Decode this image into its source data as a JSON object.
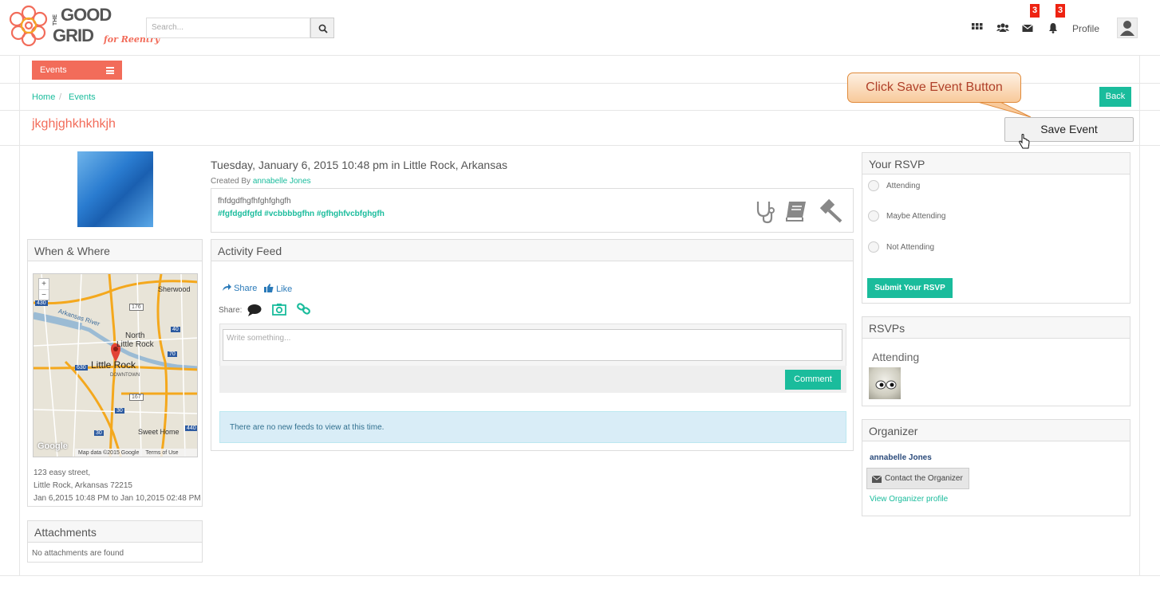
{
  "header": {
    "logo_line1": "THE",
    "logo_good": "GOOD",
    "logo_grid": "GRID",
    "logo_sub": "for Reentry",
    "search_placeholder": "Search...",
    "messages_badge": "3",
    "notifications_badge": "3",
    "profile_label": "Profile"
  },
  "nav": {
    "events_label": "Events"
  },
  "breadcrumb": {
    "home": "Home",
    "separator": "/",
    "current": "Events"
  },
  "actions": {
    "back_label": "Back",
    "save_event_label": "Save Event"
  },
  "annotation": {
    "callout_text": "Click Save Event Button"
  },
  "event": {
    "title": "jkghjghkhkhkjh",
    "date_line": "Tuesday, January 6, 2015 10:48 pm in Little Rock, Arkansas",
    "created_by_prefix": "Created By",
    "creator": "annabelle Jones",
    "description": "fhfdgdfhgfhfghfghgfh",
    "tags": "#fgfdgdfgfd #vcbbbbgfhn #gfhghfvcbfghgfh"
  },
  "when_where": {
    "heading": "When & Where",
    "address_line1": "123 easy street,",
    "address_line2": "Little Rock, Arkansas 72215",
    "date_range": "Jan 6,2015 10:48 PM to Jan 10,2015 02:48 PM",
    "map": {
      "city": "Little Rock",
      "north_label_1": "North",
      "north_label_2": "Little Rock",
      "sherwood": "Sherwood",
      "sweet_home": "Sweet Home",
      "downtown": "DOWNTOWN",
      "river": "Arkansas River",
      "credit": "Map data ©2015 Google",
      "terms": "Terms of Use",
      "google": "Google",
      "shield_430": "430",
      "shield_176": "176",
      "shield_40": "40",
      "shield_70": "70",
      "shield_630": "630",
      "shield_167": "167",
      "shield_30a": "30",
      "shield_30b": "30",
      "shield_440": "440",
      "zoom_in": "+",
      "zoom_out": "−"
    }
  },
  "attachments": {
    "heading": "Attachments",
    "empty_text": "No attachments are found"
  },
  "activity": {
    "heading": "Activity Feed",
    "share_label": "Share",
    "like_label": "Like",
    "share_prefix": "Share:",
    "textarea_placeholder": "Write something...",
    "comment_label": "Comment",
    "no_feeds": "There are no new feeds to view at this time."
  },
  "rsvp": {
    "heading": "Your RSVP",
    "options": [
      "Attending",
      "Maybe Attending",
      "Not Attending"
    ],
    "submit_label": "Submit Your RSVP"
  },
  "rsvps": {
    "heading": "RSVPs",
    "attending_label": "Attending"
  },
  "organizer": {
    "heading": "Organizer",
    "name": "annabelle Jones",
    "contact_label": "Contact the Organizer",
    "view_profile_label": "View Organizer profile"
  },
  "colors": {
    "accent_teal": "#1abc9c",
    "brand_coral": "#f26c5a",
    "badge_red": "#ee2211"
  }
}
